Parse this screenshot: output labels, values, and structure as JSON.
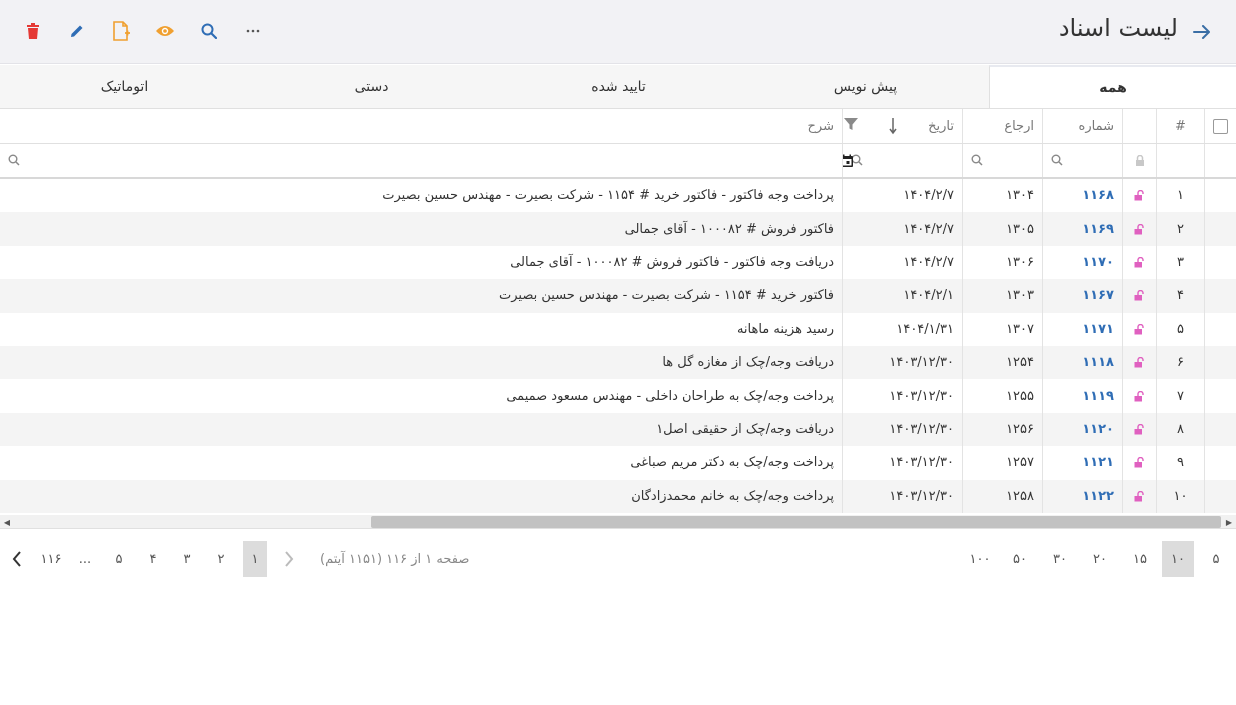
{
  "header": {
    "title": "لیست اسناد"
  },
  "tabs": [
    {
      "label": "همه",
      "active": true
    },
    {
      "label": "پیش نویس",
      "active": false
    },
    {
      "label": "تایید شده",
      "active": false
    },
    {
      "label": "دستی",
      "active": false
    },
    {
      "label": "اتوماتیک",
      "active": false
    }
  ],
  "columns": {
    "num": "#",
    "number": "شماره",
    "reference": "ارجاع",
    "date": "تاریخ",
    "description": "شرح"
  },
  "rows": [
    {
      "index": "۱",
      "number": "۱۱۶۸",
      "reference": "۱۳۰۴",
      "date": "۱۴۰۴/۲/۷",
      "description": "پرداخت وجه فاکتور - فاکتور خرید # ۱۱۵۴ - شرکت بصیرت - مهندس حسین بصیرت"
    },
    {
      "index": "۲",
      "number": "۱۱۶۹",
      "reference": "۱۳۰۵",
      "date": "۱۴۰۴/۲/۷",
      "description": "فاکتور فروش # ۱۰۰۰۸۲ - آقای جمالی"
    },
    {
      "index": "۳",
      "number": "۱۱۷۰",
      "reference": "۱۳۰۶",
      "date": "۱۴۰۴/۲/۷",
      "description": "دریافت وجه فاکتور - فاکتور فروش # ۱۰۰۰۸۲ - آقای جمالی"
    },
    {
      "index": "۴",
      "number": "۱۱۶۷",
      "reference": "۱۳۰۳",
      "date": "۱۴۰۴/۲/۱",
      "description": "فاکتور خرید # ۱۱۵۴ - شرکت بصیرت - مهندس حسین بصیرت"
    },
    {
      "index": "۵",
      "number": "۱۱۷۱",
      "reference": "۱۳۰۷",
      "date": "۱۴۰۴/۱/۳۱",
      "description": "رسید هزینه ماهانه"
    },
    {
      "index": "۶",
      "number": "۱۱۱۸",
      "reference": "۱۲۵۴",
      "date": "۱۴۰۳/۱۲/۳۰",
      "description": "دریافت وجه/چک از مغازه گل ها"
    },
    {
      "index": "۷",
      "number": "۱۱۱۹",
      "reference": "۱۲۵۵",
      "date": "۱۴۰۳/۱۲/۳۰",
      "description": "پرداخت وجه/چک به طراحان داخلی - مهندس مسعود صمیمی"
    },
    {
      "index": "۸",
      "number": "۱۱۲۰",
      "reference": "۱۲۵۶",
      "date": "۱۴۰۳/۱۲/۳۰",
      "description": "دریافت وجه/چک از حقیقی اصل۱"
    },
    {
      "index": "۹",
      "number": "۱۱۲۱",
      "reference": "۱۲۵۷",
      "date": "۱۴۰۳/۱۲/۳۰",
      "description": "پرداخت وجه/چک به دکتر مریم صباغی"
    },
    {
      "index": "۱۰",
      "number": "۱۱۲۲",
      "reference": "۱۲۵۸",
      "date": "۱۴۰۳/۱۲/۳۰",
      "description": "پرداخت وجه/چک به خانم محمدزادگان"
    }
  ],
  "pager": {
    "sizes": [
      {
        "label": "۵",
        "selected": false
      },
      {
        "label": "۱۰",
        "selected": true
      },
      {
        "label": "۱۵",
        "selected": false
      },
      {
        "label": "۲۰",
        "selected": false
      },
      {
        "label": "۳۰",
        "selected": false
      },
      {
        "label": "۵۰",
        "selected": false
      },
      {
        "label": "۱۰۰",
        "selected": false
      }
    ],
    "info": "صفحه ۱ از ۱۱۶ (۱۱۵۱ آیتم)",
    "pages": [
      {
        "label": "۱",
        "selected": true
      },
      {
        "label": "۲",
        "selected": false
      },
      {
        "label": "۳",
        "selected": false
      },
      {
        "label": "۴",
        "selected": false
      },
      {
        "label": "۵",
        "selected": false
      },
      {
        "label": "...",
        "selected": false
      },
      {
        "label": "۱۱۶",
        "selected": false
      }
    ]
  },
  "colors": {
    "accent_blue": "#2f6db5",
    "delete_red": "#e53935",
    "orange": "#f0a030",
    "lock_pink": "#e060c0"
  },
  "icons": {
    "back": "arrow-right-icon",
    "delete": "trash-icon",
    "edit": "pencil-icon",
    "new_doc": "file-plus-icon",
    "view": "eye-icon",
    "search": "search-icon",
    "more": "more-icon",
    "lock": "lock-icon",
    "sort": "sort-desc-icon",
    "filter": "funnel-icon",
    "calendar": "calendar-icon"
  }
}
